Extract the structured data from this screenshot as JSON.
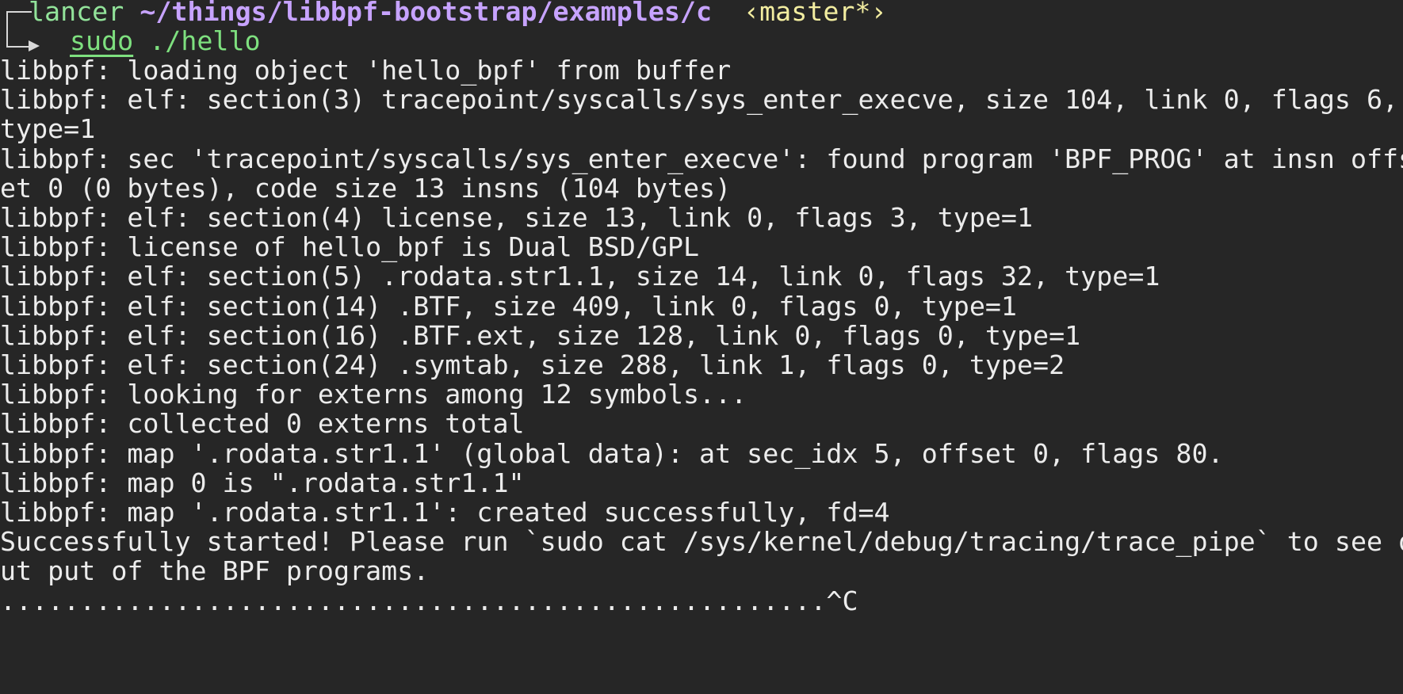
{
  "prompt": {
    "user": "lancer",
    "path": "~/things/libbpf-bootstrap/examples/c",
    "branch": "‹master*›",
    "command_sudo": "sudo",
    "command_rest": " ./hello"
  },
  "output_lines": [
    "libbpf: loading object 'hello_bpf' from buffer",
    "libbpf: elf: section(3) tracepoint/syscalls/sys_enter_execve, size 104, link 0, flags 6,",
    "type=1",
    "libbpf: sec 'tracepoint/syscalls/sys_enter_execve': found program 'BPF_PROG' at insn offs",
    "et 0 (0 bytes), code size 13 insns (104 bytes)",
    "libbpf: elf: section(4) license, size 13, link 0, flags 3, type=1",
    "libbpf: license of hello_bpf is Dual BSD/GPL",
    "libbpf: elf: section(5) .rodata.str1.1, size 14, link 0, flags 32, type=1",
    "libbpf: elf: section(14) .BTF, size 409, link 0, flags 0, type=1",
    "libbpf: elf: section(16) .BTF.ext, size 128, link 0, flags 0, type=1",
    "libbpf: elf: section(24) .symtab, size 288, link 1, flags 0, type=2",
    "libbpf: looking for externs among 12 symbols...",
    "libbpf: collected 0 externs total",
    "libbpf: map '.rodata.str1.1' (global data): at sec_idx 5, offset 0, flags 80.",
    "libbpf: map 0 is \".rodata.str1.1\"",
    "libbpf: map '.rodata.str1.1': created successfully, fd=4",
    "Successfully started! Please run `sudo cat /sys/kernel/debug/tracing/trace_pipe` to see o",
    "ut put of the BPF programs.",
    "....................................................^C"
  ],
  "colors": {
    "background": "#262626",
    "text": "#ececec",
    "user": "#92e39a",
    "path": "#c7a3ff",
    "branch": "#f2eda0",
    "command": "#7ee07f"
  },
  "icons": {
    "prompt_arrow": "prompt-arrow-icon"
  }
}
